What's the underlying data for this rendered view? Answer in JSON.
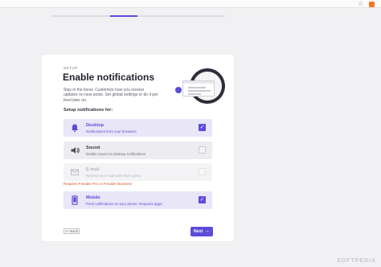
{
  "browser": {
    "star_icon": "star-icon",
    "rss_icon": "rss-icon",
    "rss_color": "#f07b22"
  },
  "step_progress": {
    "fraction": 0.5
  },
  "header": {
    "setup_label": "SETUP",
    "title": "Enable notifications",
    "description": "Stay in the know. Customize how you receive updates on new posts. Set global settings or do it per feed later on.",
    "section_title": "Setup notifications for:"
  },
  "options": [
    {
      "title": "Desktop",
      "subtitle": "Notifications from your browsers",
      "state": "active",
      "checked": true,
      "icon": "bell-icon"
    },
    {
      "title": "Sound",
      "subtitle": "Enable sound on desktop notifications",
      "state": "inactive",
      "checked": false,
      "icon": "speaker-icon"
    },
    {
      "title": "E-mail",
      "subtitle": "Receive an e-mail with entire posts",
      "state": "disabled",
      "checked": false,
      "icon": "envelope-icon"
    },
    {
      "title": "Mobile",
      "subtitle": "Push notifications on your phone. Requires apps.",
      "state": "active",
      "checked": true,
      "icon": "phone-icon"
    }
  ],
  "warning": "Requires Feedder Pro or Feedder Business",
  "footer": {
    "back_label": "<< Back",
    "next_label": "Next",
    "next_arrow": "→"
  },
  "watermark": "SOFTPEDIA",
  "colors": {
    "accent": "#5b4dd9",
    "warning": "#d7542c"
  }
}
